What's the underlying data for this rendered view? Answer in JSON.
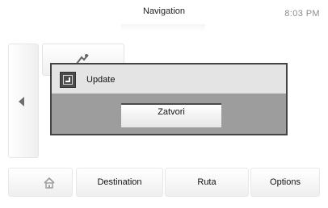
{
  "header": {
    "title": "Navigation",
    "clock": "8:03 PM"
  },
  "dialog": {
    "title": "Update",
    "close_label": "Zatvori"
  },
  "bottom_tabs": [
    {
      "icon": "home-icon",
      "label": ""
    },
    {
      "label": "Destination"
    },
    {
      "label": "Ruta"
    },
    {
      "label": "Options"
    }
  ],
  "colors": {
    "dialog_header": "#e4e4e4",
    "dialog_body": "#9d9d9d",
    "dialog_border": "#444444",
    "clock_text": "#8c8c8c"
  }
}
